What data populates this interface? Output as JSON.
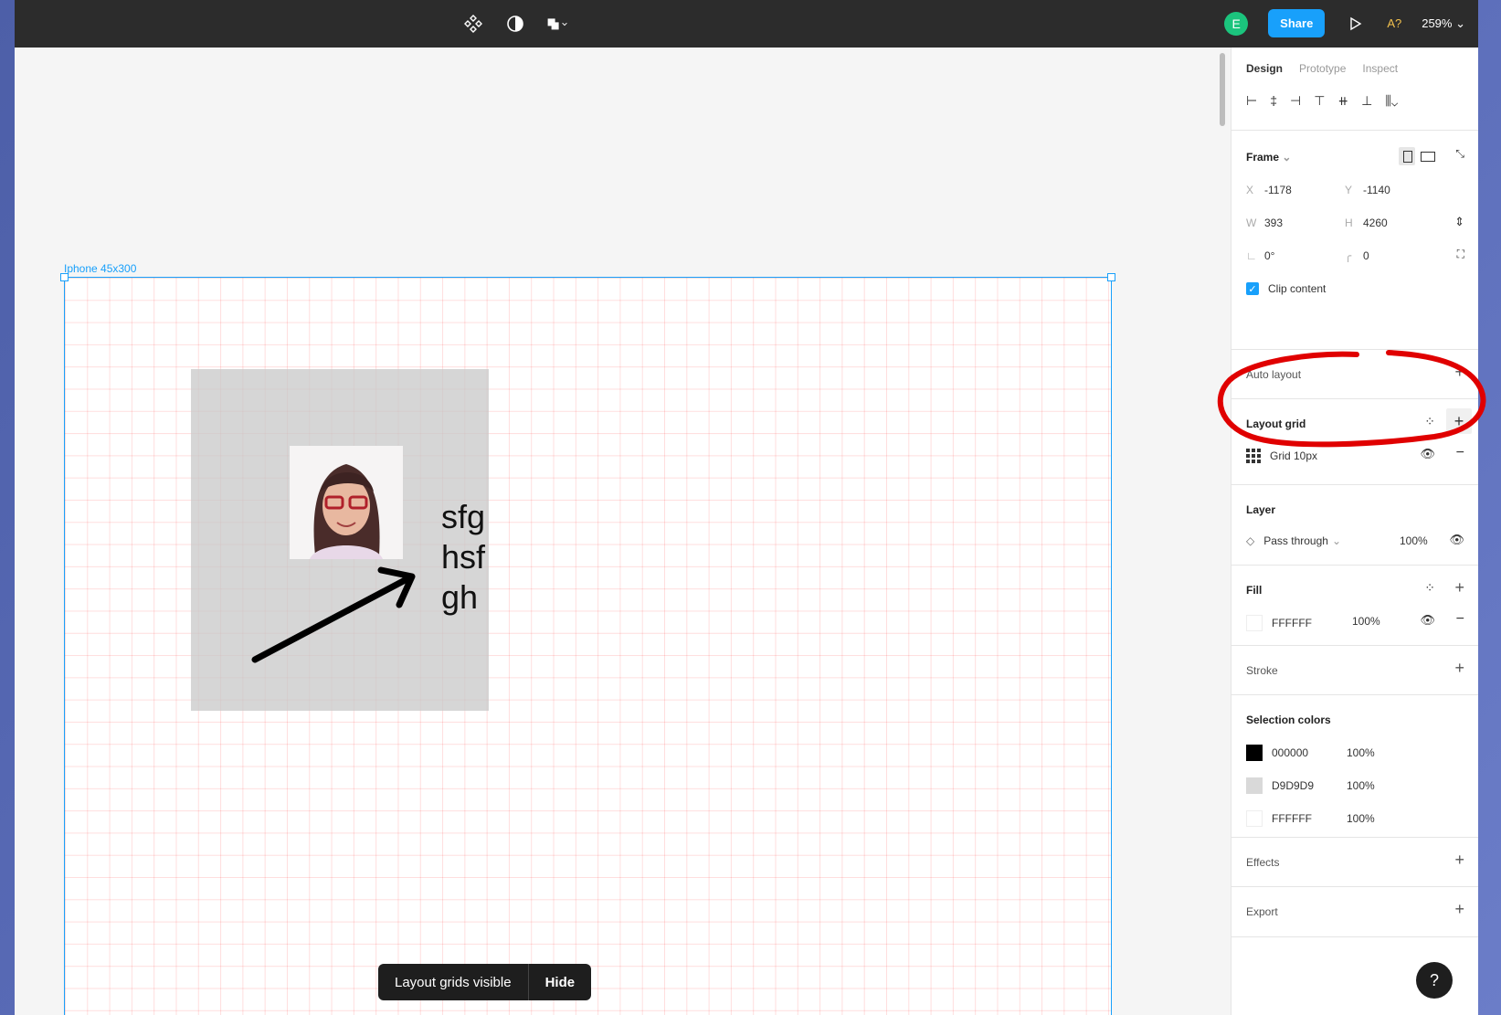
{
  "topbar": {
    "avatar_initial": "E",
    "share_label": "Share",
    "accessibility_badge": "A?",
    "zoom_level": "259%"
  },
  "canvas": {
    "frame_label": "Iphone 45x300",
    "text_lines": [
      "sfg",
      "hsf",
      "gh"
    ],
    "toast": {
      "message": "Layout grids visible",
      "action": "Hide"
    }
  },
  "panel": {
    "tabs": [
      "Design",
      "Prototype",
      "Inspect"
    ],
    "frame": {
      "title": "Frame",
      "x_label": "X",
      "x": "-1178",
      "y_label": "Y",
      "y": "-1140",
      "w_label": "W",
      "w": "393",
      "h_label": "H",
      "h": "4260",
      "rotation": "0°",
      "corner_radius": "0",
      "clip_content": "Clip content"
    },
    "auto_layout": "Auto layout",
    "layout_grid": {
      "title": "Layout grid",
      "item": "Grid 10px"
    },
    "layer": {
      "title": "Layer",
      "blend": "Pass through",
      "opacity": "100%"
    },
    "fill": {
      "title": "Fill",
      "color": "FFFFFF",
      "opacity": "100%"
    },
    "stroke": "Stroke",
    "selection_colors": {
      "title": "Selection colors",
      "items": [
        {
          "hex": "000000",
          "opacity": "100%",
          "color": "#000000"
        },
        {
          "hex": "D9D9D9",
          "opacity": "100%",
          "color": "#D9D9D9"
        },
        {
          "hex": "FFFFFF",
          "opacity": "100%",
          "color": "#FFFFFF"
        }
      ]
    },
    "effects": "Effects",
    "export": "Export"
  },
  "help_label": "?",
  "colors": {
    "accent": "#18a0fb",
    "annotation": "#e00000"
  }
}
